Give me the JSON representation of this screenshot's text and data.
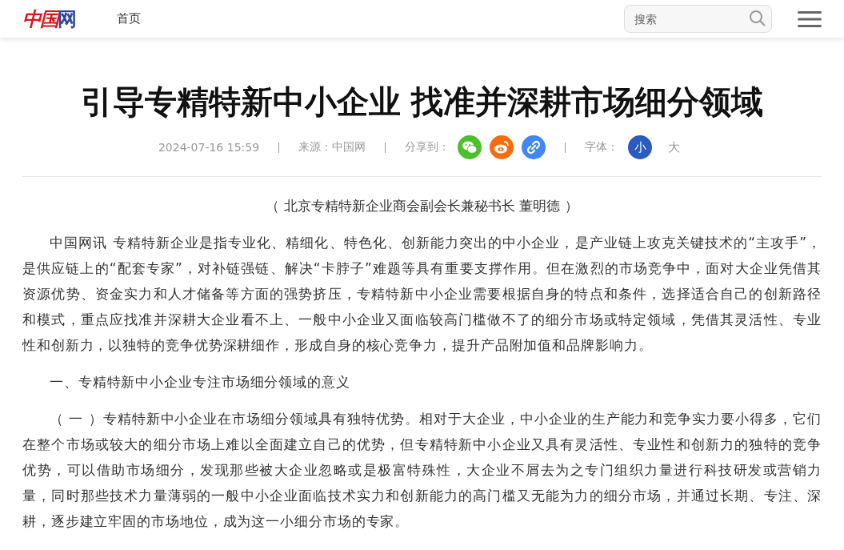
{
  "header": {
    "logo": {
      "red": "中国",
      "blue": "网"
    },
    "nav": [
      {
        "label": "首页"
      }
    ],
    "search": {
      "placeholder": "搜索"
    }
  },
  "article": {
    "title": "引导专精特新中小企业 找准并深耕市场细分领域",
    "meta": {
      "date": "2024-07-16 15:59",
      "source": "来源：中国网",
      "share_label": "分享到：",
      "share": [
        {
          "kind": "wechat",
          "color": "#4cbf2b"
        },
        {
          "kind": "weibo",
          "color": "#f56d0e"
        },
        {
          "kind": "link",
          "color": "#3f87f5"
        }
      ],
      "font_label": "字体：",
      "font_sizes": [
        {
          "label": "小",
          "selected": true
        },
        {
          "label": "大",
          "selected": false
        }
      ]
    },
    "byline": "（ 北京专精特新企业商会副会长兼秘书长 董明德 ）",
    "paragraphs": [
      "中国网讯 专精特新企业是指专业化、精细化、特色化、创新能力突出的中小企业，是产业链上攻克关键技术的“主攻手”，是供应链上的“配套专家”，对补链强链、解决“卡脖子”难题等具有重要支撑作用。但在激烈的市场竞争中，面对大企业凭借其资源优势、资金实力和人才储备等方面的强势挤压，专精特新中小企业需要根据自身的特点和条件，选择适合自己的创新路径和模式，重点应找准并深耕大企业看不上、一般中小企业又面临较高门槛做不了的细分市场或特定领域，凭借其灵活性、专业性和创新力，以独特的竞争优势深耕细作，形成自身的核心竞争力，提升产品附加值和品牌影响力。",
      "一、专精特新中小企业专注市场细分领域的意义",
      "（ 一 ）专精特新中小企业在市场细分领域具有独特优势。相对于大企业，中小企业的生产能力和竞争实力要小得多，它们在整个市场或较大的细分市场上难以全面建立自己的优势，但专精特新中小企业又具有灵活性、专业性和创新力的独特的竞争优势，可以借助市场细分，发现那些被大企业忽略或是极富特殊性，大企业不屑去为之专门组织力量进行科技研发或营销力量，同时那些技术力量薄弱的一般中小企业面临技术实力和创新能力的高门槛又无能为力的细分市场，并通过长期、专注、深耕，逐步建立牢固的市场地位，成为这一小细分市场的专家。"
    ]
  }
}
